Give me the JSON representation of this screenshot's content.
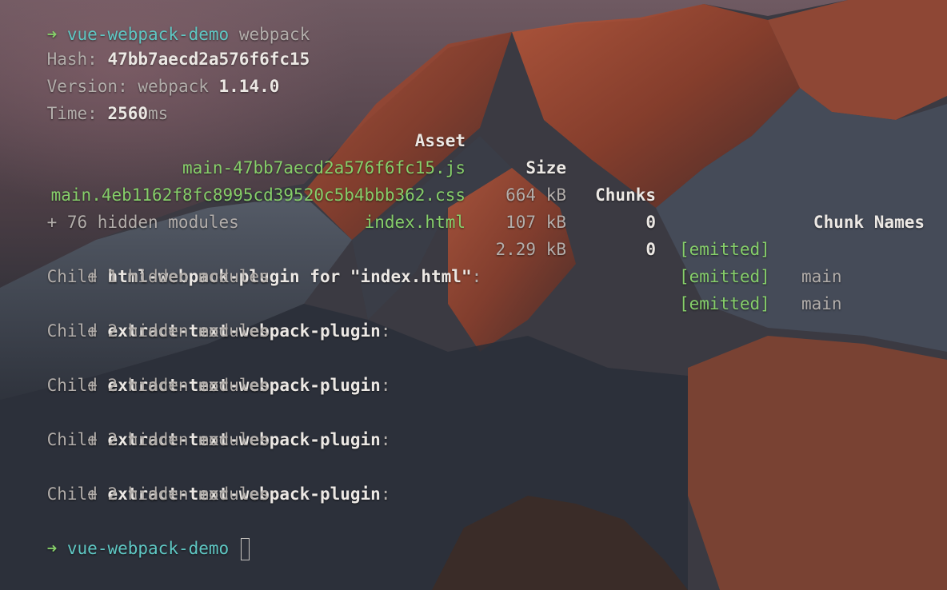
{
  "prompt": {
    "arrow": "➜",
    "directory": "vue-webpack-demo",
    "command": "webpack"
  },
  "stats": {
    "hash_label": "Hash: ",
    "hash_value": "47bb7aecd2a576f6fc15",
    "version_label": "Version: webpack ",
    "version_value": "1.14.0",
    "time_label": "Time: ",
    "time_value": "2560",
    "time_unit": "ms"
  },
  "asset_table": {
    "headers": {
      "asset": "Asset",
      "size": "Size",
      "chunks": "Chunks",
      "chunk_names": "Chunk Names"
    },
    "rows": [
      {
        "asset": "main-47bb7aecd2a576f6fc15.js",
        "size": "664 kB",
        "chunks": "0",
        "status": "[emitted]",
        "name": "main"
      },
      {
        "asset": "main.4eb1162f8fc8995cd39520c5b4bbb362.css",
        "size": "107 kB",
        "chunks": "0",
        "status": "[emitted]",
        "name": "main"
      },
      {
        "asset": "index.html",
        "size": "2.29 kB",
        "chunks": "",
        "status": "[emitted]",
        "name": ""
      }
    ]
  },
  "hidden_modules_main": "    + 76 hidden modules",
  "children": [
    {
      "prefix": "Child ",
      "name": "html-webpack-plugin for \"index.html\"",
      "suffix": ":",
      "modules": "        + 1 hidden modules"
    },
    {
      "prefix": "Child ",
      "name": "extract-text-webpack-plugin",
      "suffix": ":",
      "modules": "        + 2 hidden modules"
    },
    {
      "prefix": "Child ",
      "name": "extract-text-webpack-plugin",
      "suffix": ":",
      "modules": "        + 2 hidden modules"
    },
    {
      "prefix": "Child ",
      "name": "extract-text-webpack-plugin",
      "suffix": ":",
      "modules": "        + 2 hidden modules"
    },
    {
      "prefix": "Child ",
      "name": "extract-text-webpack-plugin",
      "suffix": ":",
      "modules": "        + 2 hidden modules"
    }
  ],
  "final_prompt": {
    "arrow": "➜",
    "directory": "vue-webpack-demo"
  },
  "colors": {
    "green": "#86cf6a",
    "teal": "#5fc8c4",
    "bright": "#ece8e4",
    "dim": "#b3aeab"
  }
}
